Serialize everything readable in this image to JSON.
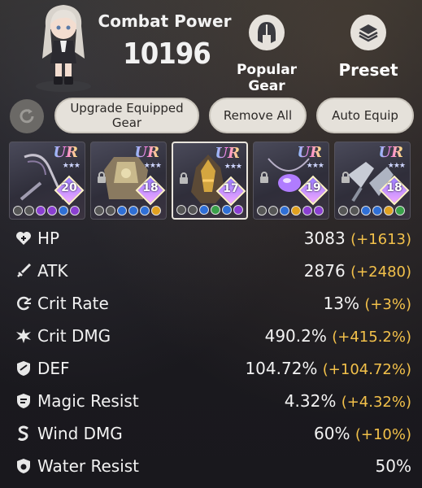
{
  "header": {
    "combat_power_label": "Combat Power",
    "combat_power_value": "10196",
    "popular_gear_label": "Popular Gear",
    "preset_label": "Preset"
  },
  "actions": {
    "upgrade_label": "Upgrade Equipped Gear",
    "remove_all_label": "Remove All",
    "auto_equip_label": "Auto Equip"
  },
  "gear": [
    {
      "rarity": "UR",
      "level": "20",
      "locked": false,
      "selected": false,
      "item": "staff"
    },
    {
      "rarity": "UR",
      "level": "18",
      "locked": true,
      "selected": false,
      "item": "armor"
    },
    {
      "rarity": "UR",
      "level": "17",
      "locked": true,
      "selected": true,
      "item": "helmet"
    },
    {
      "rarity": "UR",
      "level": "19",
      "locked": true,
      "selected": false,
      "item": "amulet"
    },
    {
      "rarity": "UR",
      "level": "18",
      "locked": true,
      "selected": false,
      "item": "gauntlets"
    }
  ],
  "stats": [
    {
      "icon": "heart-plus-icon",
      "name": "HP",
      "value": "3083",
      "bonus": "(+1613)"
    },
    {
      "icon": "sword-icon",
      "name": "ATK",
      "value": "2876",
      "bonus": "(+2480)"
    },
    {
      "icon": "crit-rate-icon",
      "name": "Crit Rate",
      "value": "13%",
      "bonus": "(+3%)"
    },
    {
      "icon": "crit-dmg-icon",
      "name": "Crit DMG",
      "value": "490.2%",
      "bonus": "(+415.2%)"
    },
    {
      "icon": "shield-icon",
      "name": "DEF",
      "value": "104.72%",
      "bonus": "(+104.72%)"
    },
    {
      "icon": "magic-shield-icon",
      "name": "Magic Resist",
      "value": "4.32%",
      "bonus": "(+4.32%)"
    },
    {
      "icon": "wind-icon",
      "name": "Wind DMG",
      "value": "60%",
      "bonus": "(+10%)"
    },
    {
      "icon": "water-shield-icon",
      "name": "Water Resist",
      "value": "50%",
      "bonus": ""
    }
  ],
  "colors": {
    "bonus": "#f3c14a",
    "button": "#e5e1da"
  }
}
